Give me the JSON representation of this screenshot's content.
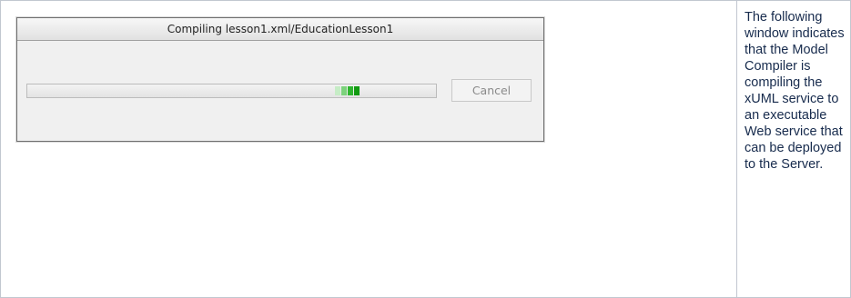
{
  "dialog": {
    "title": "Compiling lesson1.xml/EducationLesson1",
    "cancel_label": "Cancel",
    "progress_indeterminate": true
  },
  "description": {
    "text": "The following window indicates that the Model Compiler is compiling the xUML service to an executable Web service that can be deployed to the Server."
  },
  "colors": {
    "progress_green": "#119a11",
    "table_border": "#c1c7d0",
    "text": "#172b4d"
  }
}
